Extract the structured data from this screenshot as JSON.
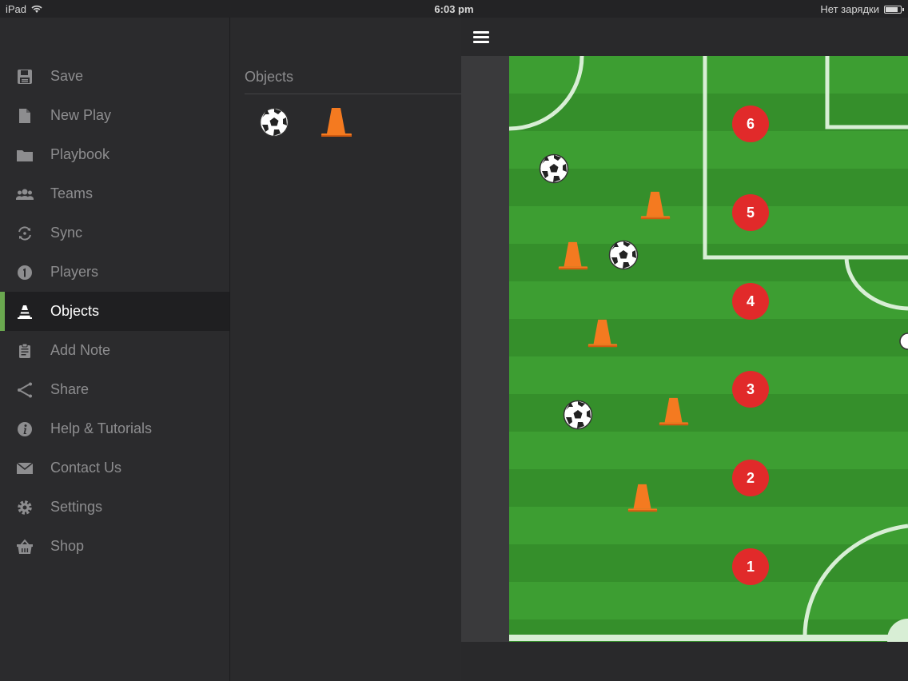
{
  "status_bar": {
    "device": "iPad",
    "time": "6:03 pm",
    "charging_text": "Нет зарядки"
  },
  "menu": {
    "items": [
      {
        "label": "Save",
        "icon": "save-icon"
      },
      {
        "label": "New Play",
        "icon": "document-icon"
      },
      {
        "label": "Playbook",
        "icon": "folder-icon"
      },
      {
        "label": "Teams",
        "icon": "users-icon"
      },
      {
        "label": "Sync",
        "icon": "sync-icon"
      },
      {
        "label": "Players",
        "icon": "number-one-icon"
      },
      {
        "label": "Objects",
        "icon": "cone-icon",
        "active": true
      },
      {
        "label": "Add Note",
        "icon": "clipboard-icon"
      },
      {
        "label": "Share",
        "icon": "share-icon"
      },
      {
        "label": "Help & Tutorials",
        "icon": "info-icon"
      },
      {
        "label": "Contact Us",
        "icon": "mail-icon"
      },
      {
        "label": "Settings",
        "icon": "gear-icon"
      },
      {
        "label": "Shop",
        "icon": "basket-icon"
      }
    ]
  },
  "objects_panel": {
    "title": "Objects",
    "palette": [
      "soccer-ball",
      "cone"
    ]
  },
  "field": {
    "players": [
      "6",
      "5",
      "4",
      "3",
      "2",
      "1"
    ],
    "colors": {
      "grass_light": "#3d9e32",
      "grass_dark": "#358f2b",
      "player": "#e12a2a",
      "cone": "#f47a20",
      "lines": "#d8eed5",
      "accent": "#6aa84f"
    }
  }
}
